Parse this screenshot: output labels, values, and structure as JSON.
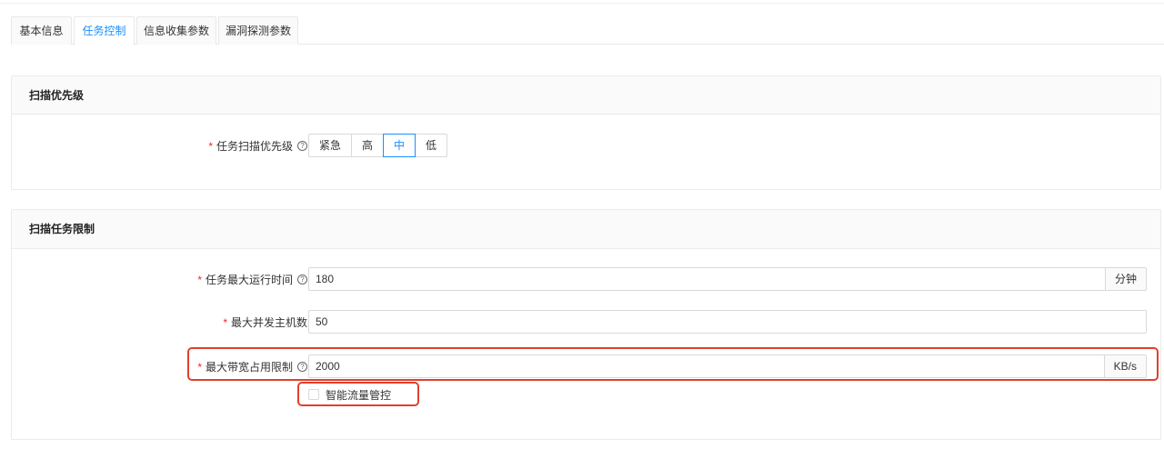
{
  "tabs": [
    {
      "label": "基本信息",
      "active": false
    },
    {
      "label": "任务控制",
      "active": true
    },
    {
      "label": "信息收集参数",
      "active": false
    },
    {
      "label": "漏洞探测参数",
      "active": false
    }
  ],
  "priority_section": {
    "title": "扫描优先级",
    "field_label": "任务扫描优先级",
    "options": [
      "紧急",
      "高",
      "中",
      "低"
    ],
    "selected": "中"
  },
  "limit_section": {
    "title": "扫描任务限制",
    "max_runtime": {
      "label": "任务最大运行时间",
      "value": "180",
      "unit": "分钟"
    },
    "max_hosts": {
      "label": "最大并发主机数",
      "value": "50"
    },
    "max_bandwidth": {
      "label": "最大带宽占用限制",
      "value": "2000",
      "unit": "KB/s"
    },
    "smart_traffic": {
      "label": "智能流量管控",
      "checked": false
    }
  },
  "help_icon": "question-circle-icon",
  "colors": {
    "accent": "#1890ff",
    "required": "#f5222d",
    "highlight": "#e0412b"
  }
}
